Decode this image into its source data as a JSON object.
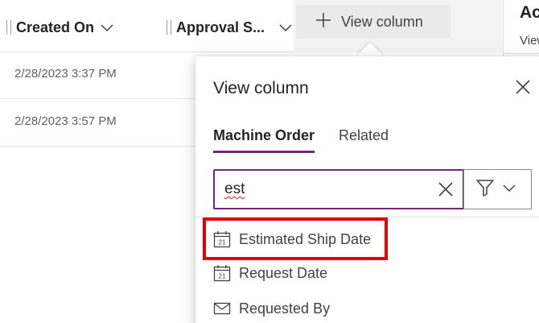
{
  "grid": {
    "columns": [
      {
        "label": "Created On"
      },
      {
        "label": "Approval S..."
      }
    ],
    "rows": [
      {
        "created_on": "2/28/2023 3:37 PM"
      },
      {
        "created_on": "2/28/2023 3:57 PM"
      }
    ]
  },
  "toolbar": {
    "view_column_label": "View column"
  },
  "side_panel": {
    "title": "Ac",
    "subtitle": "View"
  },
  "popover": {
    "title": "View column",
    "tabs": [
      {
        "label": "Machine Order",
        "selected": true
      },
      {
        "label": "Related",
        "selected": false
      }
    ],
    "search": {
      "value": "est"
    },
    "results": [
      {
        "label": "Estimated Ship Date",
        "icon": "calendar-icon"
      },
      {
        "label": "Request Date",
        "icon": "calendar-icon"
      },
      {
        "label": "Requested By",
        "icon": "mail-icon"
      }
    ],
    "calendar_icon_text": "21"
  },
  "colors": {
    "accent": "#742774",
    "highlight": "#e00000"
  }
}
